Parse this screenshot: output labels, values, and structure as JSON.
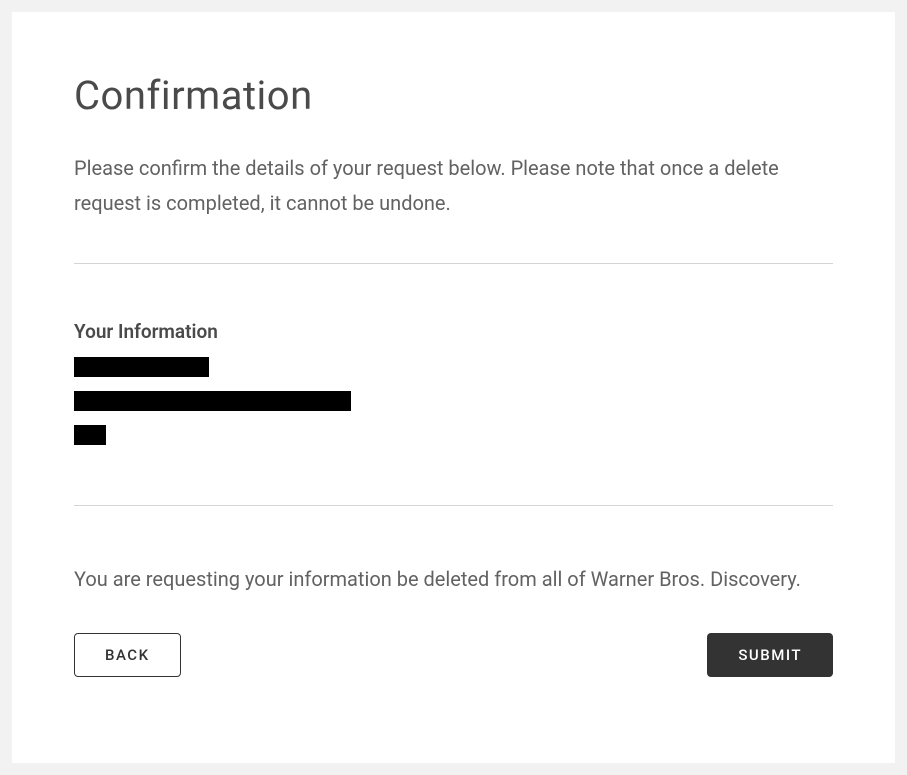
{
  "title": "Confirmation",
  "description": "Please confirm the details of your request below. Please note that once a delete request is completed, it cannot be undone.",
  "info_heading": "Your Information",
  "request_text": "You are requesting your information be deleted from all of Warner Bros. Discovery.",
  "buttons": {
    "back": "BACK",
    "submit": "SUBMIT"
  }
}
